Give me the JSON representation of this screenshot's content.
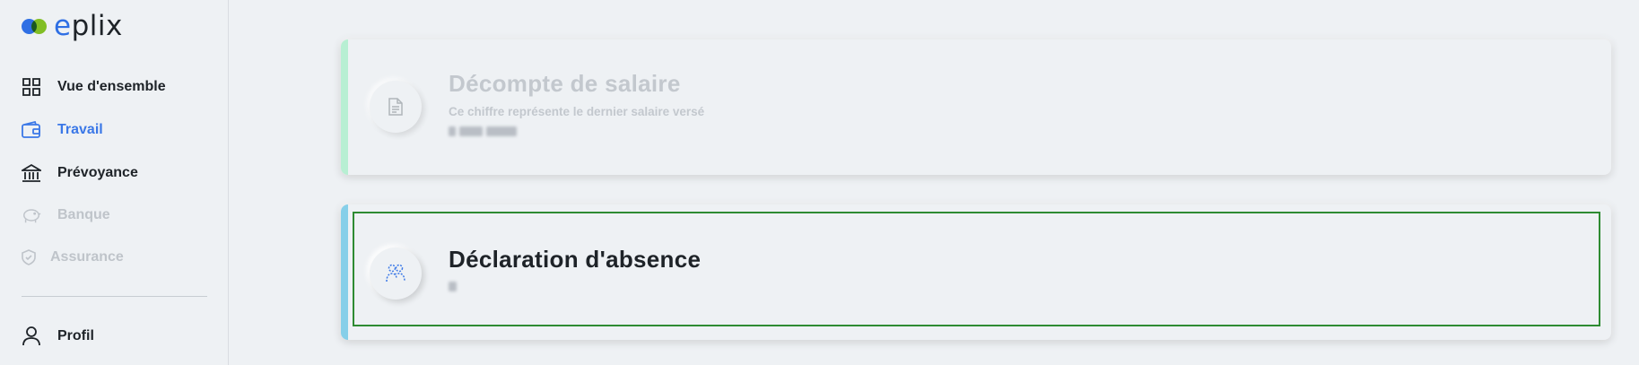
{
  "app": {
    "logo_prefix": "e",
    "logo_suffix": "plix"
  },
  "sidebar": {
    "items": [
      {
        "label": "Vue d'ensemble",
        "icon": "grid-icon",
        "state": "normal"
      },
      {
        "label": "Travail",
        "icon": "wallet-icon",
        "state": "active"
      },
      {
        "label": "Prévoyance",
        "icon": "bank-icon",
        "state": "normal"
      },
      {
        "label": "Banque",
        "icon": "piggy-bank-icon",
        "state": "disabled"
      },
      {
        "label": "Assurance",
        "icon": "shield-icon",
        "state": "disabled"
      }
    ],
    "profile": {
      "label": "Profil",
      "icon": "user-icon"
    }
  },
  "cards": [
    {
      "title": "Décompte de salaire",
      "subtitle": "Ce chiffre représente le dernier salaire versé",
      "icon": "document-icon",
      "accent": "#b8efd3",
      "state": "disabled"
    },
    {
      "title": "Déclaration d'absence",
      "subtitle": "",
      "icon": "people-icon",
      "accent": "#86cfe9",
      "state": "normal"
    }
  ],
  "colors": {
    "accent_blue": "#3b78e7",
    "highlight_green": "#2e8b32"
  }
}
